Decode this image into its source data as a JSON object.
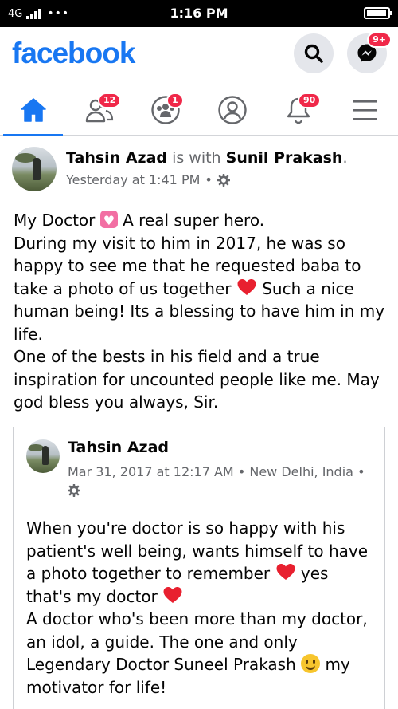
{
  "status_bar": {
    "network": "4G",
    "dots": "•••",
    "time": "1:16 PM"
  },
  "header": {
    "logo": "facebook",
    "search_icon": "search-icon",
    "messenger_icon": "messenger-icon",
    "messenger_badge": "9+"
  },
  "nav": {
    "tabs": [
      {
        "name": "home",
        "icon": "home-icon",
        "badge": ""
      },
      {
        "name": "friends",
        "icon": "friends-icon",
        "badge": "12"
      },
      {
        "name": "groups",
        "icon": "groups-icon",
        "badge": "1"
      },
      {
        "name": "profile",
        "icon": "profile-icon",
        "badge": ""
      },
      {
        "name": "notifications",
        "icon": "bell-icon",
        "badge": "90"
      },
      {
        "name": "menu",
        "icon": "menu-icon",
        "badge": ""
      }
    ],
    "accent": "#1877f2",
    "badge_color": "#f02849"
  },
  "post": {
    "author": "Tahsin Azad",
    "with_text": "is with",
    "tagged": "Sunil Prakash",
    "tagged_suffix": ".",
    "time": "Yesterday at 1:41 PM",
    "sep": "•",
    "privacy_icon": "gear-icon",
    "lines": [
      [
        "My Doctor ",
        "",
        " A real super hero."
      ],
      [
        "During my visit to him in 2017, he was so"
      ],
      [
        "happy to see me that he requested baba to"
      ],
      [
        "take a photo of us together ",
        "",
        " Such a nice"
      ],
      [
        "human being! Its a blessing to have him in my"
      ],
      [
        "life."
      ],
      [
        "One of the bests in his field and a true"
      ],
      [
        "inspiration for uncounted people like me. May"
      ],
      [
        "god bless you always, Sir."
      ]
    ]
  },
  "shared": {
    "author": "Tahsin Azad",
    "date": "Mar 31, 2017 at 12:17 AM",
    "sep": "•",
    "location": "New Delhi, India",
    "sep2": "•",
    "privacy_icon": "gear-icon",
    "lines": [
      [
        "When you're doctor is so happy with his"
      ],
      [
        "patient's well being, wants himself to have"
      ],
      [
        "a photo together to remember ",
        "",
        " yes"
      ],
      [
        "that's my doctor ",
        ""
      ],
      [
        "A doctor who's been more than my doctor,"
      ],
      [
        "an idol, a guide. The one and only"
      ],
      [
        "Legendary Doctor Suneel Prakash ",
        "",
        " my"
      ],
      [
        "motivator for life!"
      ]
    ]
  }
}
